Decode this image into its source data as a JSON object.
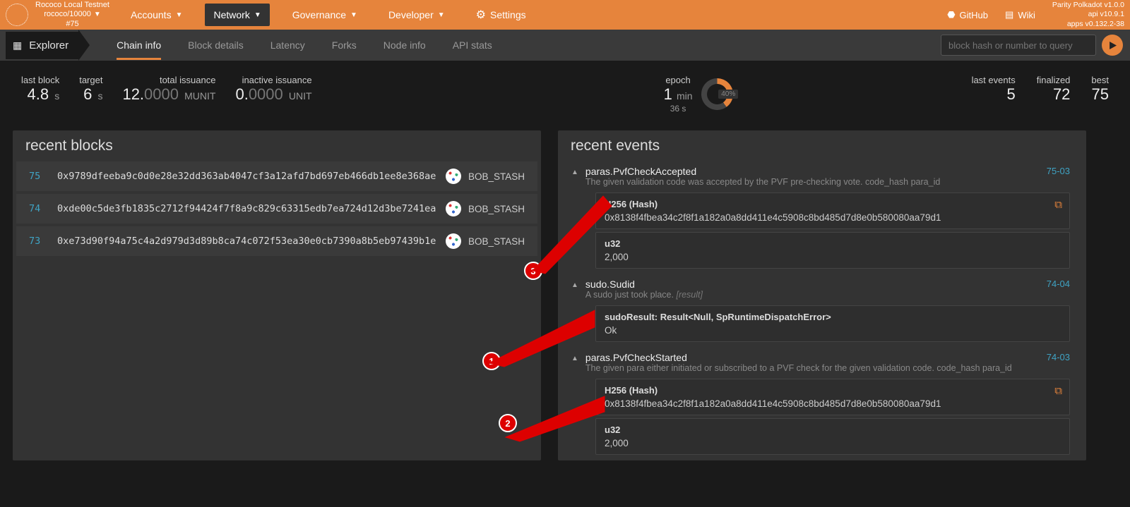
{
  "topbar": {
    "network_name": "Rococo Local Testnet",
    "network_sub": "rococo/10000",
    "block_ref": "#75",
    "menu": {
      "accounts": "Accounts",
      "network": "Network",
      "governance": "Governance",
      "developer": "Developer",
      "settings": "Settings"
    },
    "links": {
      "github": "GitHub",
      "wiki": "Wiki"
    },
    "versions": {
      "line1": "Parity Polkadot v1.0.0",
      "line2": "api v10.9.1",
      "line3": "apps v0.132.2-38"
    }
  },
  "secondbar": {
    "explorer": "Explorer",
    "tabs": {
      "chain_info": "Chain info",
      "block_details": "Block details",
      "latency": "Latency",
      "forks": "Forks",
      "node_info": "Node info",
      "api_stats": "API stats"
    },
    "search_placeholder": "block hash or number to query"
  },
  "stats": {
    "last_block": {
      "label": "last block",
      "value": "4.8",
      "suffix": "s"
    },
    "target": {
      "label": "target",
      "value": "6",
      "suffix": "s"
    },
    "total_issuance": {
      "label": "total issuance",
      "whole": "12.",
      "frac": "0000",
      "unit": "MUNIT"
    },
    "inactive_issuance": {
      "label": "inactive issuance",
      "whole": "0.",
      "frac": "0000",
      "unit": "UNIT"
    },
    "epoch": {
      "label": "epoch",
      "value": "1",
      "suffix": "min",
      "subvalue": "36 s",
      "percent": "40%"
    },
    "last_events": {
      "label": "last events",
      "value": "5"
    },
    "finalized": {
      "label": "finalized",
      "value": "72"
    },
    "best": {
      "label": "best",
      "value": "75"
    }
  },
  "blocks": {
    "header": "recent blocks",
    "rows": [
      {
        "num": "75",
        "hash": "0x9789dfeeba9c0d0e28e32dd363ab4047cf3a12afd7bd697eb466db1ee8e368ae",
        "validator": "BOB_STASH"
      },
      {
        "num": "74",
        "hash": "0xde00c5de3fb1835c2712f94424f7f8a9c829c63315edb7ea724d12d3be7241ea",
        "validator": "BOB_STASH"
      },
      {
        "num": "73",
        "hash": "0xe73d90f94a75c4a2d979d3d89b8ca74c072f53ea30e0cb7390a8b5eb97439b1e",
        "validator": "BOB_STASH"
      }
    ]
  },
  "events": {
    "header": "recent events",
    "items": [
      {
        "title": "paras.PvfCheckAccepted",
        "desc": "The given validation code was accepted by the PVF pre-checking vote. code_hash para_id",
        "ref": "75-03",
        "fields": [
          {
            "label": "H256 (Hash)",
            "value": "0x8138f4fbea34c2f8f1a182a0a8dd411e4c5908c8bd485d7d8e0b580080aa79d1",
            "copy": true
          },
          {
            "label": "u32",
            "value": "2,000"
          }
        ]
      },
      {
        "title": "sudo.Sudid",
        "desc_pre": "A sudo just took place. ",
        "desc_em": "[result]",
        "ref": "74-04",
        "fields": [
          {
            "label": "sudoResult: Result<Null, SpRuntimeDispatchError>",
            "value": "Ok"
          }
        ]
      },
      {
        "title": "paras.PvfCheckStarted",
        "desc": "The given para either initiated or subscribed to a PVF check for the given validation code. code_hash para_id",
        "ref": "74-03",
        "fields": [
          {
            "label": "H256 (Hash)",
            "value": "0x8138f4fbea34c2f8f1a182a0a8dd411e4c5908c8bd485d7d8e0b580080aa79d1",
            "copy": true
          },
          {
            "label": "u32",
            "value": "2,000"
          }
        ]
      }
    ]
  },
  "annotations": {
    "b1": "1",
    "b2": "2",
    "b3": "3"
  }
}
